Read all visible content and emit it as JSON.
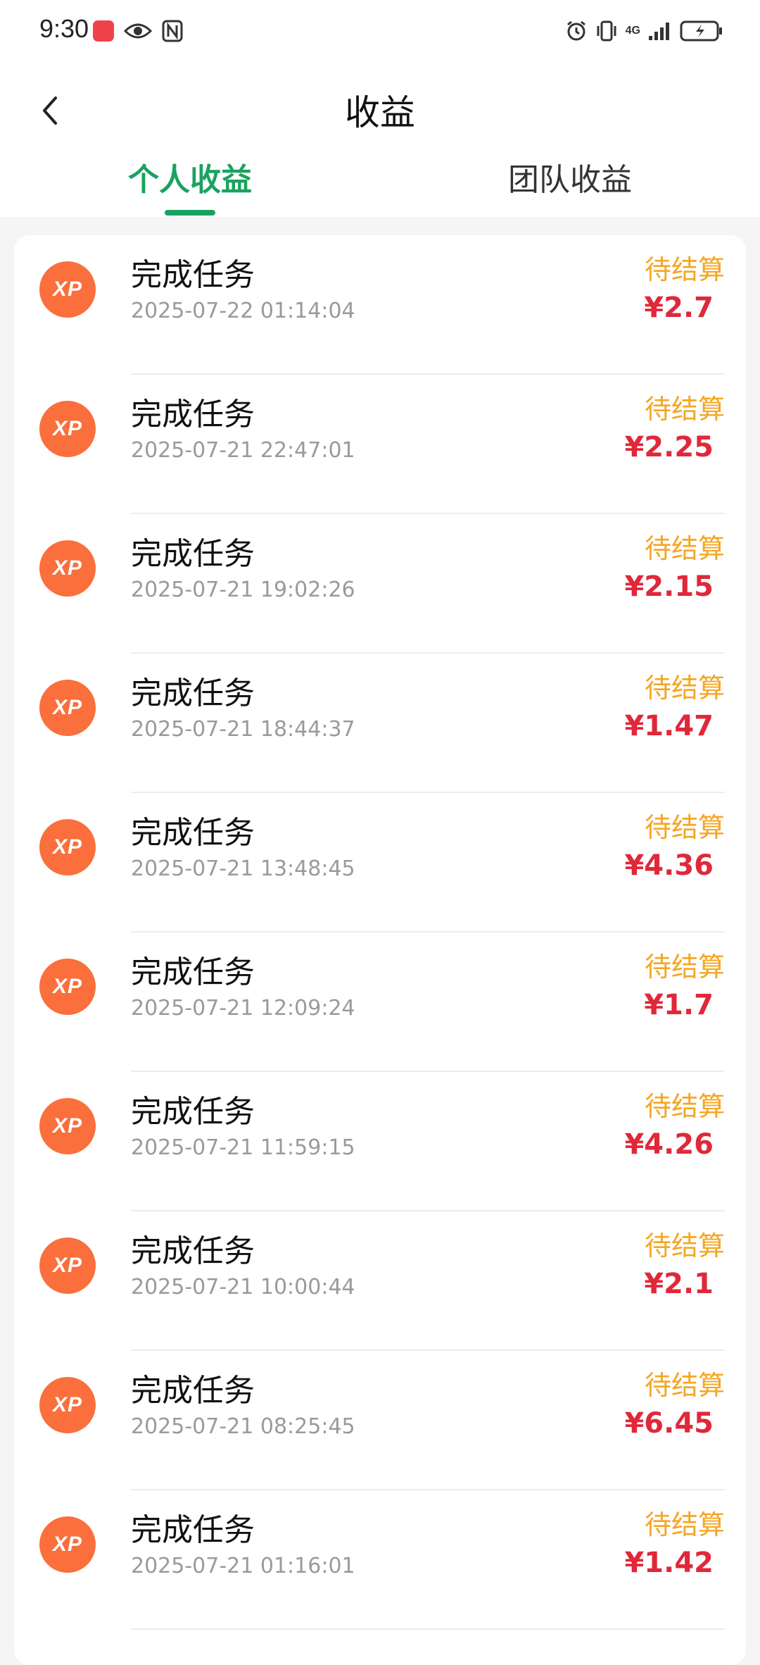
{
  "status_bar": {
    "time": "9:30",
    "network": "4G"
  },
  "header": {
    "title": "收益"
  },
  "tabs": [
    {
      "label": "个人收益",
      "active": true
    },
    {
      "label": "团队收益",
      "active": false
    }
  ],
  "colors": {
    "accent": "#1aa260",
    "status": "#f5a623",
    "amount": "#e0283a",
    "icon_bg": "#fa6f3c"
  },
  "records": [
    {
      "icon": "XP",
      "title": "完成任务",
      "time": "2025-07-22 01:14:04",
      "status": "待结算",
      "amount": "¥2.7"
    },
    {
      "icon": "XP",
      "title": "完成任务",
      "time": "2025-07-21 22:47:01",
      "status": "待结算",
      "amount": "¥2.25"
    },
    {
      "icon": "XP",
      "title": "完成任务",
      "time": "2025-07-21 19:02:26",
      "status": "待结算",
      "amount": "¥2.15"
    },
    {
      "icon": "XP",
      "title": "完成任务",
      "time": "2025-07-21 18:44:37",
      "status": "待结算",
      "amount": "¥1.47"
    },
    {
      "icon": "XP",
      "title": "完成任务",
      "time": "2025-07-21 13:48:45",
      "status": "待结算",
      "amount": "¥4.36"
    },
    {
      "icon": "XP",
      "title": "完成任务",
      "time": "2025-07-21 12:09:24",
      "status": "待结算",
      "amount": "¥1.7"
    },
    {
      "icon": "XP",
      "title": "完成任务",
      "time": "2025-07-21 11:59:15",
      "status": "待结算",
      "amount": "¥4.26"
    },
    {
      "icon": "XP",
      "title": "完成任务",
      "time": "2025-07-21 10:00:44",
      "status": "待结算",
      "amount": "¥2.1"
    },
    {
      "icon": "XP",
      "title": "完成任务",
      "time": "2025-07-21 08:25:45",
      "status": "待结算",
      "amount": "¥6.45"
    },
    {
      "icon": "XP",
      "title": "完成任务",
      "time": "2025-07-21 01:16:01",
      "status": "待结算",
      "amount": "¥1.42"
    }
  ]
}
